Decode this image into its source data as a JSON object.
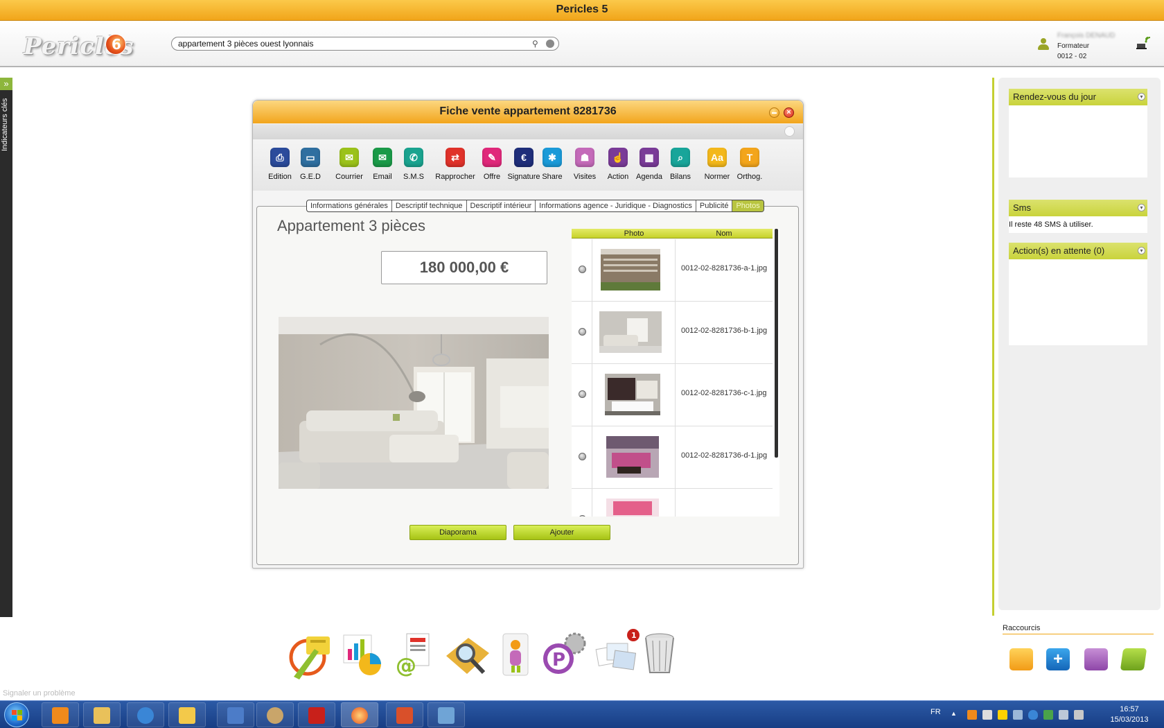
{
  "app": {
    "title": "Pericles 5"
  },
  "header": {
    "search_value": "appartement 3 pièces ouest lyonnais",
    "user": {
      "name": "François DENAUD",
      "role": "Formateur",
      "agency": "0012 - 02"
    }
  },
  "left_strip": {
    "label": "Indicateurs clés"
  },
  "window": {
    "title": "Fiche vente appartement 8281736",
    "toolbar": [
      {
        "label": "Edition",
        "color": "#2b4b9b",
        "glyph": "⎙"
      },
      {
        "label": "G.E.D",
        "color": "#2f6fa0",
        "glyph": "▭"
      },
      {
        "label": "Courrier",
        "color": "#9bc21a",
        "glyph": "✉"
      },
      {
        "label": "Email",
        "color": "#1a9a48",
        "glyph": "✉"
      },
      {
        "label": "S.M.S",
        "color": "#1aa38f",
        "glyph": "✆"
      },
      {
        "label": "Rapprocher",
        "color": "#e0322a",
        "glyph": "⇄"
      },
      {
        "label": "Offre",
        "color": "#e0287a",
        "glyph": "✎"
      },
      {
        "label": "Signature",
        "color": "#1f2e7a",
        "glyph": "€"
      },
      {
        "label": "Share",
        "color": "#1a9ad8",
        "glyph": "✱"
      },
      {
        "label": "Visites",
        "color": "#c46ab9",
        "glyph": "☗"
      },
      {
        "label": "Action",
        "color": "#7a3b98",
        "glyph": "☝"
      },
      {
        "label": "Agenda",
        "color": "#7a3b98",
        "glyph": "▦"
      },
      {
        "label": "Bilans",
        "color": "#18a59a",
        "glyph": "⌕"
      },
      {
        "label": "Normer",
        "color": "#f3b81b",
        "glyph": "Aa"
      },
      {
        "label": "Orthog.",
        "color": "#f3a51b",
        "glyph": "T"
      }
    ],
    "tabs": [
      {
        "label": "Informations générales",
        "active": false
      },
      {
        "label": "Descriptif technique",
        "active": false
      },
      {
        "label": "Descriptif intérieur",
        "active": false
      },
      {
        "label": "Informations agence - Juridique - Diagnostics",
        "active": false
      },
      {
        "label": "Publicité",
        "active": false
      },
      {
        "label": "Photos",
        "active": true
      }
    ],
    "property_title": "Appartement 3 pièces",
    "price": "180 000,00 €",
    "photo_table": {
      "col_photo": "Photo",
      "col_nom": "Nom",
      "rows": [
        {
          "name": "0012-02-8281736-a-1.jpg"
        },
        {
          "name": "0012-02-8281736-b-1.jpg"
        },
        {
          "name": "0012-02-8281736-c-1.jpg"
        },
        {
          "name": "0012-02-8281736-d-1.jpg"
        },
        {
          "name": ""
        }
      ]
    },
    "buttons": {
      "diaporama": "Diaporama",
      "ajouter": "Ajouter"
    }
  },
  "right_panel": {
    "rdv": {
      "title": "Rendez-vous du jour"
    },
    "sms": {
      "title": "Sms",
      "text": "Il reste 48 SMS à utiliser."
    },
    "actions": {
      "title": "Action(s) en attente (0)"
    }
  },
  "raccourcis": {
    "title": "Raccourcis"
  },
  "dock": {
    "notification_count": "1"
  },
  "footer": {
    "signal_text": "Signaler un problème"
  },
  "taskbar": {
    "lang": "FR",
    "time": "16:57",
    "date": "15/03/2013"
  },
  "colors": {
    "accent_orange": "#f2a51c",
    "accent_green": "#c4cf31"
  }
}
